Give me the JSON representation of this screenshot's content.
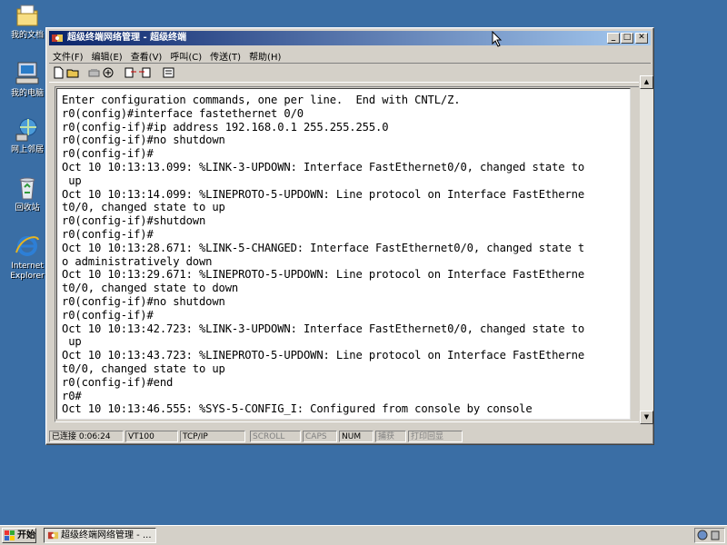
{
  "desktop": {
    "icons": [
      {
        "label": "我的文档",
        "icon": "my-documents-icon"
      },
      {
        "label": "我的电脑",
        "icon": "my-computer-icon"
      },
      {
        "label": "网上邻居",
        "icon": "network-places-icon"
      },
      {
        "label": "回收站",
        "icon": "recycle-bin-icon"
      },
      {
        "label": "Internet\nExplorer",
        "icon": "internet-explorer-icon"
      }
    ]
  },
  "window": {
    "title": "超级终端网络管理 - 超级终端",
    "menu": [
      "文件(F)",
      "编辑(E)",
      "查看(V)",
      "呼叫(C)",
      "传送(T)",
      "帮助(H)"
    ],
    "toolbar_icons": [
      "new-icon",
      "open-icon",
      "disconnect-icon",
      "call-icon",
      "send-icon",
      "receive-icon",
      "properties-icon"
    ]
  },
  "terminal": {
    "lines": [
      "Enter configuration commands, one per line.  End with CNTL/Z.",
      "r0(config)#interface fastethernet 0/0",
      "r0(config-if)#ip address 192.168.0.1 255.255.255.0",
      "r0(config-if)#no shutdown",
      "r0(config-if)#",
      "Oct 10 10:13:13.099: %LINK-3-UPDOWN: Interface FastEthernet0/0, changed state to",
      " up",
      "Oct 10 10:13:14.099: %LINEPROTO-5-UPDOWN: Line protocol on Interface FastEtherne",
      "t0/0, changed state to up",
      "r0(config-if)#shutdown",
      "r0(config-if)#",
      "Oct 10 10:13:28.671: %LINK-5-CHANGED: Interface FastEthernet0/0, changed state t",
      "o administratively down",
      "Oct 10 10:13:29.671: %LINEPROTO-5-UPDOWN: Line protocol on Interface FastEtherne",
      "t0/0, changed state to down",
      "r0(config-if)#no shutdown",
      "r0(config-if)#",
      "Oct 10 10:13:42.723: %LINK-3-UPDOWN: Interface FastEthernet0/0, changed state to",
      " up",
      "Oct 10 10:13:43.723: %LINEPROTO-5-UPDOWN: Line protocol on Interface FastEtherne",
      "t0/0, changed state to up",
      "r0(config-if)#end",
      "r0#",
      "Oct 10 10:13:46.555: %SYS-5-CONFIG_I: Configured from console by console"
    ]
  },
  "statusbar": {
    "connected": "已连接 0:06:24",
    "emulation": "VT100",
    "protocol": "TCP/IP",
    "scroll": "SCROLL",
    "caps": "CAPS",
    "num": "NUM",
    "capture": "捕获",
    "echo": "打印回显"
  },
  "taskbar": {
    "start": "开始",
    "task": "超级终端网络管理 - ..."
  },
  "colors": {
    "desktop": "#3a6ea5",
    "title_start": "#0a246a",
    "title_end": "#a6caf0",
    "chrome": "#d4d0c8"
  }
}
